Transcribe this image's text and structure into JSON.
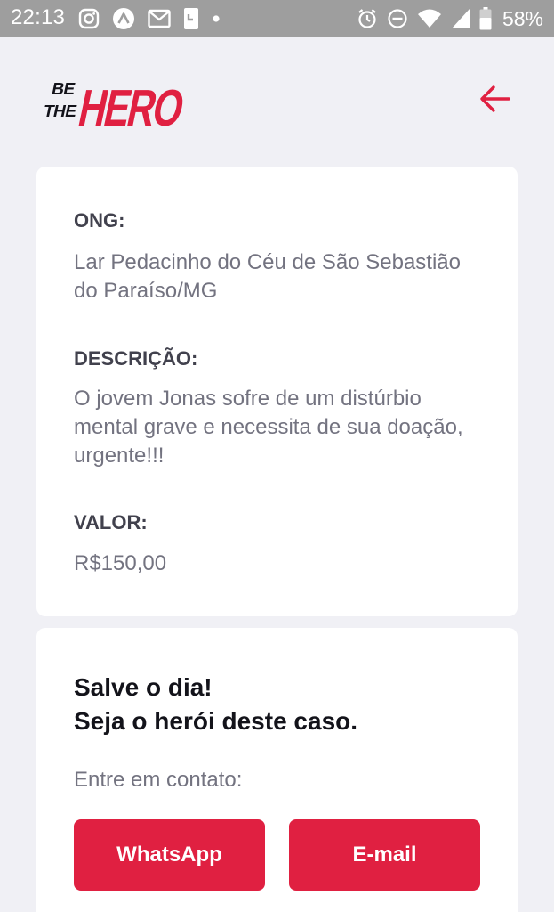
{
  "status_bar": {
    "time": "22:13",
    "battery": "58%",
    "left_icons": [
      "instagram-icon",
      "app-icon",
      "gmail-icon",
      "phone-notification-icon",
      "dot-icon"
    ],
    "right_icons": [
      "alarm-icon",
      "do-not-disturb-icon",
      "wifi-icon",
      "signal-icon",
      "battery-icon"
    ]
  },
  "header": {
    "logo_text": "BE THE HERO",
    "back_icon": "arrow-left-icon"
  },
  "incident": {
    "ong_label": "ONG:",
    "ong_value": "Lar Pedacinho do Céu de São Sebastião do Paraíso/MG",
    "description_label": "DESCRIÇÃO:",
    "description_value": "O jovem Jonas sofre de um distúrbio mental grave e necessita de sua doação, urgente!!!",
    "value_label": "VALOR:",
    "value_value": "R$150,00"
  },
  "contact": {
    "title_line1": "Salve o dia!",
    "title_line2": "Seja o herói deste caso.",
    "subtitle": "Entre em contato:",
    "whatsapp_label": "WhatsApp",
    "email_label": "E-mail"
  },
  "colors": {
    "accent": "#e02041",
    "background": "#f0f0f5",
    "card": "#ffffff",
    "label": "#41414d",
    "text": "#737380",
    "title": "#13131a",
    "status_bar": "#9e9e9e"
  }
}
